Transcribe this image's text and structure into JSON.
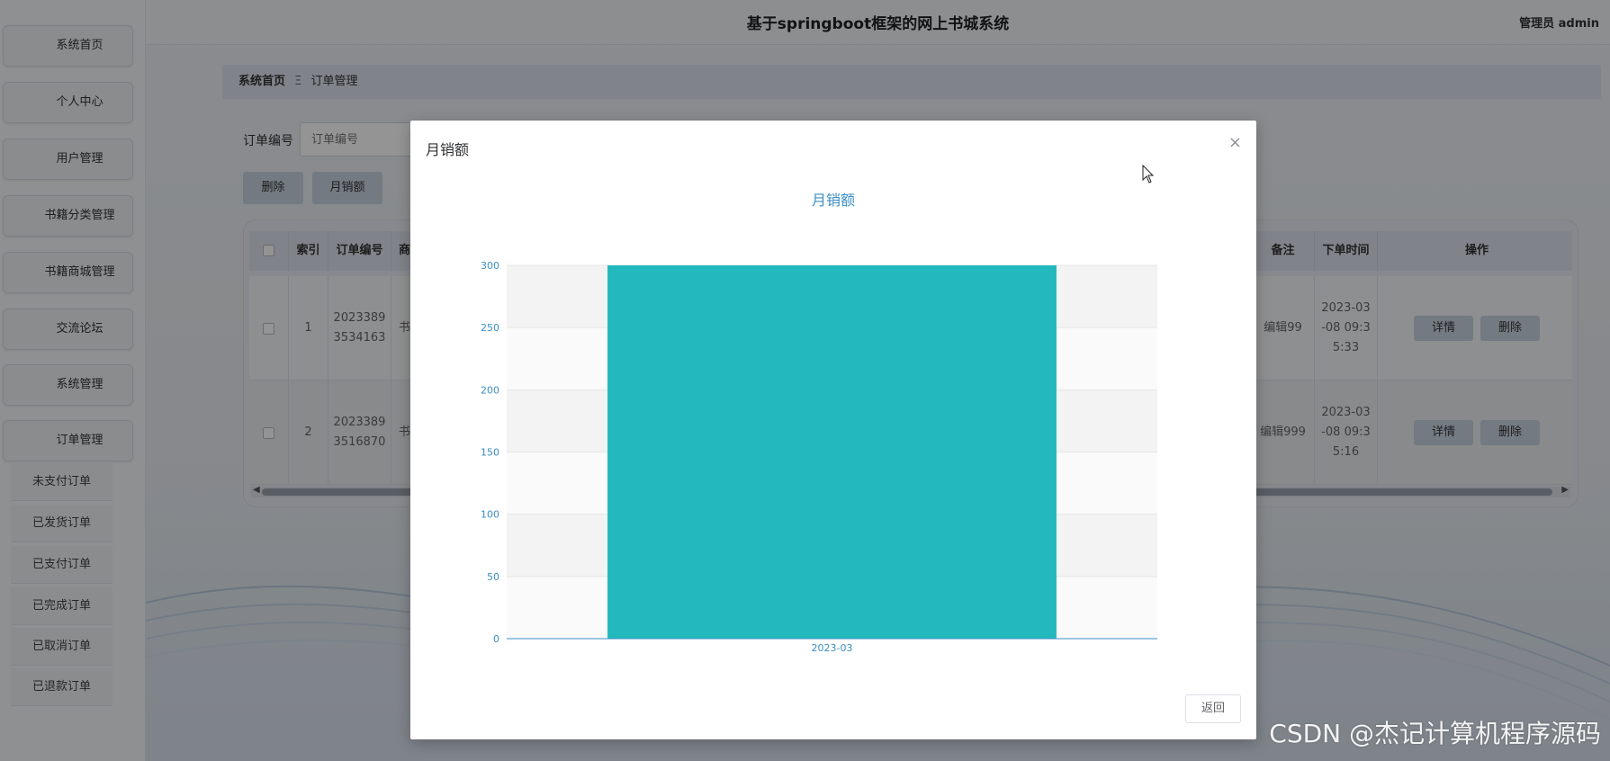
{
  "header": {
    "title": "基于springboot框架的网上书城系统",
    "user": "管理员 admin"
  },
  "sidebar": {
    "items": [
      {
        "label": "系统首页"
      },
      {
        "label": "个人中心"
      },
      {
        "label": "用户管理"
      },
      {
        "label": "书籍分类管理"
      },
      {
        "label": "书籍商城管理"
      },
      {
        "label": "交流论坛"
      },
      {
        "label": "系统管理"
      },
      {
        "label": "订单管理"
      }
    ],
    "subitems": [
      {
        "label": "未支付订单"
      },
      {
        "label": "已发货订单"
      },
      {
        "label": "已支付订单"
      },
      {
        "label": "已完成订单"
      },
      {
        "label": "已取消订单"
      },
      {
        "label": "已退款订单"
      }
    ]
  },
  "breadcrumb": {
    "home": "系统首页",
    "separator": "Ξ",
    "current": "订单管理"
  },
  "search": {
    "label": "订单编号",
    "placeholder": "订单编号"
  },
  "toolbar": {
    "delete_label": "删除",
    "monthly_sales_label": "月销额"
  },
  "table": {
    "headers": {
      "index": "索引",
      "order_no": "订单编号",
      "product": "商",
      "remark": "备注",
      "order_time": "下单时间",
      "actions": "操作"
    },
    "rows": [
      {
        "index": "1",
        "order_no_1": "2023389",
        "order_no_2": "3534163",
        "product": "书",
        "remark": "编辑99",
        "time_1": "2023-03",
        "time_2": "-08 09:3",
        "time_3": "5:33",
        "detail": "详情",
        "delete": "删除"
      },
      {
        "index": "2",
        "order_no_1": "2023389",
        "order_no_2": "3516870",
        "product": "书",
        "remark": "编辑999",
        "time_1": "2023-03",
        "time_2": "-08 09:3",
        "time_3": "5:16",
        "detail": "详情",
        "delete": "删除"
      }
    ]
  },
  "modal": {
    "title": "月销额",
    "close_icon": "×",
    "back_label": "返回"
  },
  "chart_data": {
    "type": "bar",
    "title": "月销额",
    "categories": [
      "2023-03"
    ],
    "values": [
      300
    ],
    "ylim": [
      0,
      300
    ],
    "yticks": [
      "0",
      "50",
      "100",
      "150",
      "200",
      "250",
      "300"
    ],
    "grid": true,
    "bar_color": "#22b8bd",
    "axis_color": "#3a8fc4"
  },
  "watermark": "CSDN @杰记计算机程序源码"
}
